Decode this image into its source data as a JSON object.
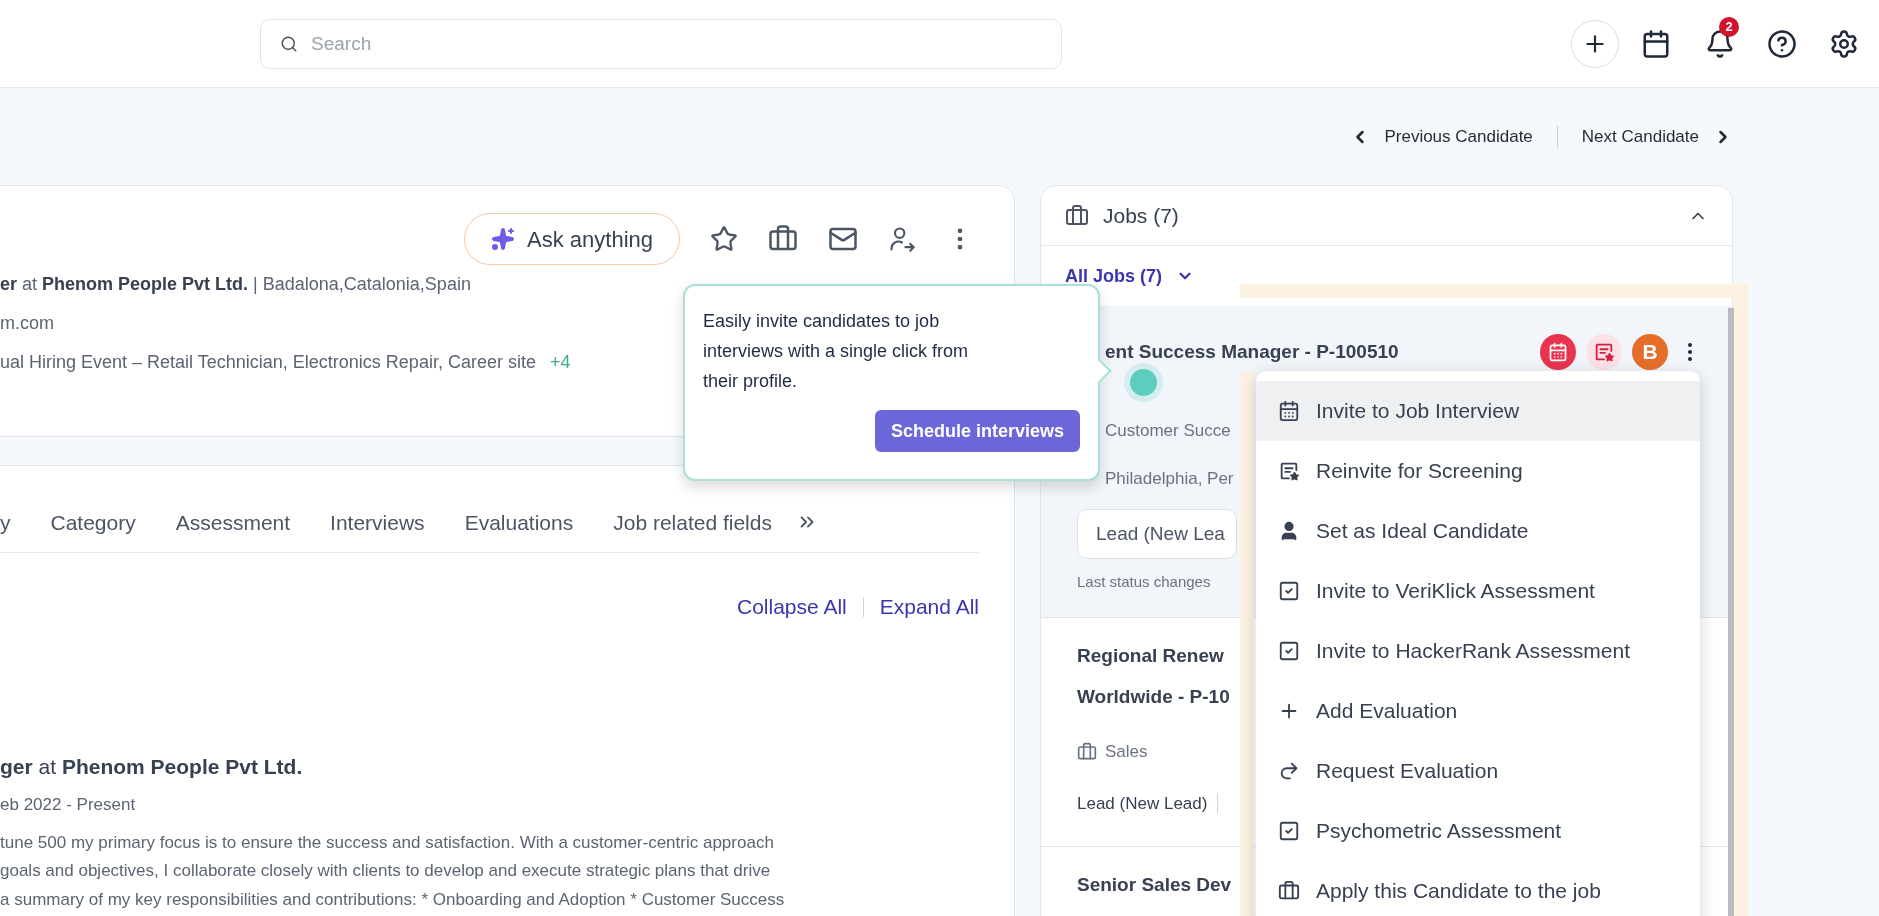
{
  "header": {
    "search": {
      "placeholder": "Search"
    },
    "notifications_badge": "2"
  },
  "navigation": {
    "previous": "Previous Candidate",
    "next": "Next Candidate"
  },
  "profile": {
    "ask_button": "Ask anything",
    "headline": "**er** at **Phenom People Pvt Ltd.** | Badalona,Catalonia,Spain",
    "email": "m.com",
    "sources": "ual Hiring Event – Retail Technician, Electronics Repair, Career site",
    "sources_more": "+4"
  },
  "tabs": [
    {
      "label": "y",
      "selected": false
    },
    {
      "label": "Category",
      "selected": false
    },
    {
      "label": "Assessment",
      "selected": false
    },
    {
      "label": "Interviews",
      "selected": false
    },
    {
      "label": "Evaluations",
      "selected": false
    },
    {
      "label": "Job related fields",
      "selected": false
    }
  ],
  "section_actions": [
    "Collapse All",
    "Expand All"
  ],
  "experience": {
    "title": "**ger** at **Phenom People Pvt Ltd.**",
    "dates": "eb 2022 - Present",
    "description_lines": [
      "tune 500 my primary focus is to ensure the success and satisfaction. With a customer-centric approach",
      "goals and objectives, I collaborate closely with clients to develop and execute strategic plans that drive",
      "a summary of my key responsibilities and contributions: * Onboarding and Adoption * Customer Success"
    ]
  },
  "tooltip": {
    "text": "Easily invite candidates to job interviews with a single click from their profile.",
    "button": "Schedule interviews"
  },
  "jobs_panel": {
    "title": "Jobs (7)",
    "expanded": true,
    "filter": "All Jobs (7)",
    "active_job": {
      "title": "ent Success Manager - P-100510",
      "department": "Customer Succe",
      "location": "Philadelphia, Per",
      "status_field": "Lead (New Lea",
      "last_status": "Last status changes",
      "avatar": "B"
    },
    "jobs": [
      {
        "title": "Regional Renew",
        "title_line2": "Worldwide - P-10",
        "department": "Sales",
        "status": "Lead (New Lead)"
      },
      {
        "title": "Senior Sales Dev"
      }
    ]
  },
  "menu": [
    {
      "label": "Invite to Job Interview",
      "selected": true
    },
    {
      "label": "Reinvite for Screening",
      "selected": false
    },
    {
      "label": "Set as Ideal Candidate",
      "selected": false
    },
    {
      "label": "Invite to VeriKlick Assessment",
      "selected": false
    },
    {
      "label": "Invite to HackerRank Assessment",
      "selected": false
    },
    {
      "label": "Add Evaluation",
      "selected": false
    },
    {
      "label": "Request Evaluation",
      "selected": false
    },
    {
      "label": "Psychometric Assessment",
      "selected": false
    },
    {
      "label": "Apply this Candidate to the job",
      "selected": false
    }
  ]
}
